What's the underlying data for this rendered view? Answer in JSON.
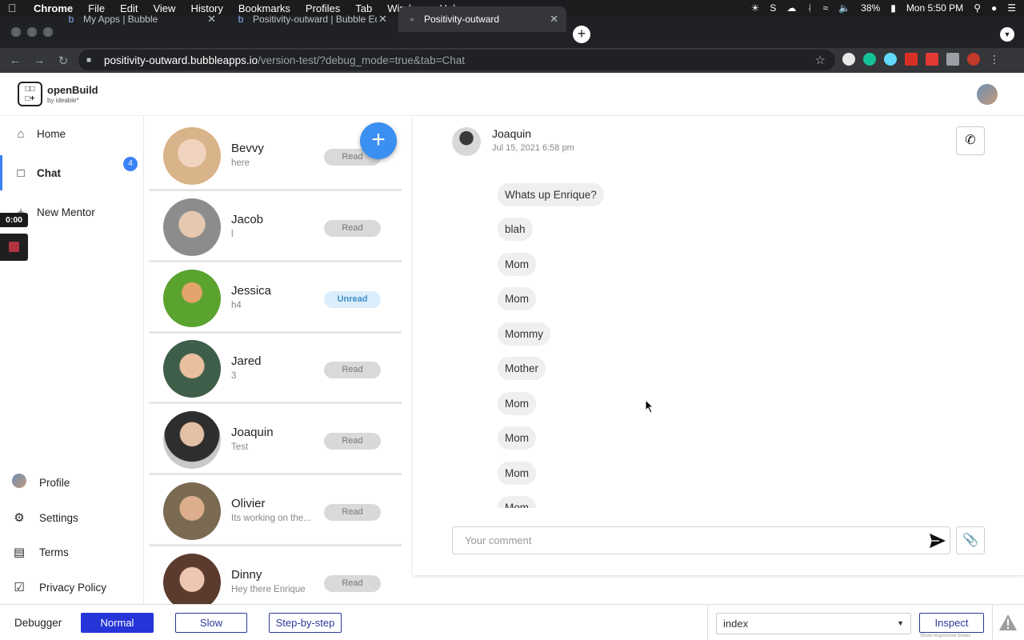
{
  "menubar": {
    "app": "Chrome",
    "items": [
      "File",
      "Edit",
      "View",
      "History",
      "Bookmarks",
      "Profiles",
      "Tab",
      "Window",
      "Help"
    ],
    "battery": "38%",
    "clock": "Mon 5:50 PM"
  },
  "browser": {
    "tabs": [
      {
        "title": "My Apps | Bubble"
      },
      {
        "title": "Positivity-outward | Bubble Edi"
      },
      {
        "title": "Positivity-outward"
      }
    ],
    "url_host": "positivity-outward.bubbleapps.io",
    "url_path": "/version-test/?debug_mode=true&tab=Chat"
  },
  "header": {
    "logo_title": "openBuild",
    "logo_sub": "by ideable*"
  },
  "nav": {
    "home": "Home",
    "chat": "Chat",
    "chat_badge": "4",
    "new_mentor": "New Mentor",
    "profile": "Profile",
    "settings": "Settings",
    "terms": "Terms",
    "privacy": "Privacy Policy"
  },
  "recorder": {
    "time": "0:00"
  },
  "contacts": [
    {
      "name": "Bevvy",
      "message": "here",
      "status": "Read",
      "unread": false,
      "color": "#d9b48a"
    },
    {
      "name": "Jacob",
      "message": "l",
      "status": "Read",
      "unread": false,
      "color": "#8c8c8c"
    },
    {
      "name": "Jessica",
      "message": "h4",
      "status": "Unread",
      "unread": true,
      "color": "#5aa32f"
    },
    {
      "name": "Jared",
      "message": "3",
      "status": "Read",
      "unread": false,
      "color": "#3f5e4a"
    },
    {
      "name": "Joaquin",
      "message": "Test",
      "status": "Read",
      "unread": false,
      "color": "#c9c9c9"
    },
    {
      "name": "Olivier",
      "message": "Its working on the...",
      "status": "Read",
      "unread": false,
      "color": "#7a6a52"
    },
    {
      "name": "Dinny",
      "message": "Hey there Enrique",
      "status": "Read",
      "unread": false,
      "color": "#5a3b2e"
    }
  ],
  "chat": {
    "name": "Joaquin",
    "date": "Jul 15, 2021 6:58 pm",
    "messages": [
      "Whats up Enrique?",
      "blah",
      "Mom",
      "Mom",
      "Mommy",
      "Mother",
      "Mom",
      "Mom",
      "Mom",
      "Mom"
    ],
    "comment_placeholder": "Your comment"
  },
  "debugger": {
    "label": "Debugger",
    "normal": "Normal",
    "slow": "Slow",
    "step": "Step-by-step",
    "page_select": "index",
    "inspect": "Inspect",
    "inspect_sub": "Show responsive boxes"
  },
  "colors": {
    "accent": "#3b82f6",
    "debug_active": "#2535d8"
  }
}
